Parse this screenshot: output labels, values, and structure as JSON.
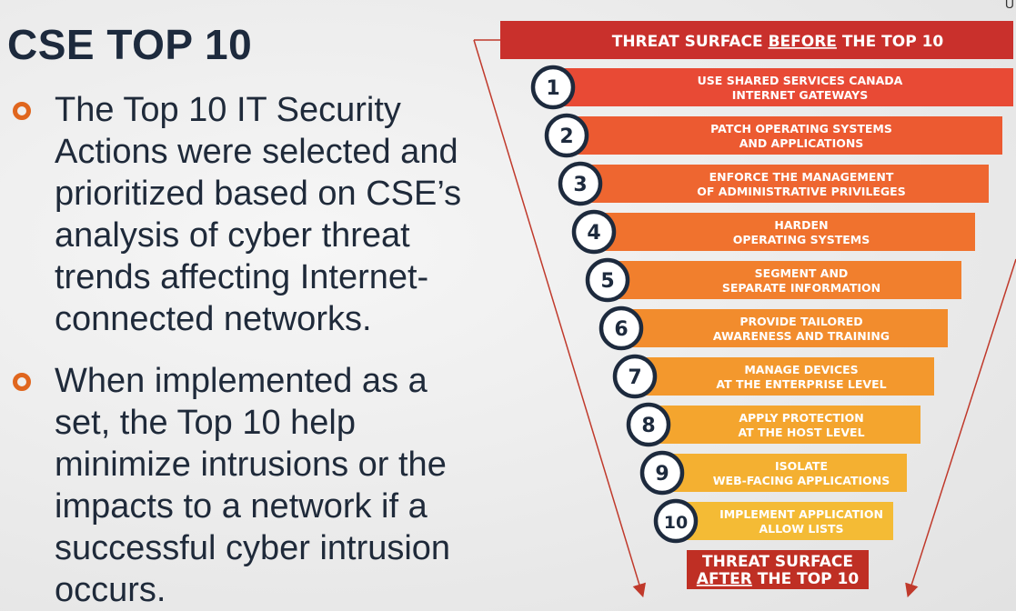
{
  "slide": {
    "title": "CSE TOP 10",
    "corner_text": "U",
    "bullets": [
      "The Top 10 IT Security Actions were selected and prioritized based on CSE’s analysis of cyber threat trends affecting Internet-connected networks.",
      "When implemented as a set, the Top 10 help minimize intrusions or the impacts to a network if a successful cyber intrusion occurs."
    ]
  },
  "funnel": {
    "header": {
      "prefix": "THREAT SURFACE ",
      "emph": "BEFORE",
      "suffix": " THE TOP 10",
      "color": "#c9302c"
    },
    "footer": {
      "line1": "THREAT SURFACE",
      "line2_emph": "AFTER",
      "line2_rest": " THE TOP 10",
      "color": "#bf2f24"
    },
    "steps": [
      {
        "number": "1",
        "line1": "USE SHARED SERVICES CANADA",
        "line2": "INTERNET GATEWAYS",
        "color": "#e84a35"
      },
      {
        "number": "2",
        "line1": "PATCH OPERATING SYSTEMS",
        "line2": "AND APPLICATIONS",
        "color": "#ec5a31"
      },
      {
        "number": "3",
        "line1": "ENFORCE THE MANAGEMENT",
        "line2": "OF ADMINISTRATIVE PRIVILEGES",
        "color": "#ee6630"
      },
      {
        "number": "4",
        "line1": "HARDEN",
        "line2": "OPERATING SYSTEMS",
        "color": "#f0722e"
      },
      {
        "number": "5",
        "line1": "SEGMENT AND",
        "line2": "SEPARATE INFORMATION",
        "color": "#f17f2d"
      },
      {
        "number": "6",
        "line1": "PROVIDE TAILORED",
        "line2": "AWARENESS AND TRAINING",
        "color": "#f28c2d"
      },
      {
        "number": "7",
        "line1": "MANAGE DEVICES",
        "line2": "AT THE ENTERPRISE LEVEL",
        "color": "#f3982d"
      },
      {
        "number": "8",
        "line1": "APPLY PROTECTION",
        "line2": "AT THE HOST LEVEL",
        "color": "#f4a52e"
      },
      {
        "number": "9",
        "line1": "ISOLATE",
        "line2": "WEB-FACING APPLICATIONS",
        "color": "#f4b031"
      },
      {
        "number": "10",
        "line1": "IMPLEMENT APPLICATION",
        "line2": "ALLOW LISTS",
        "color": "#f4bb35"
      }
    ]
  }
}
